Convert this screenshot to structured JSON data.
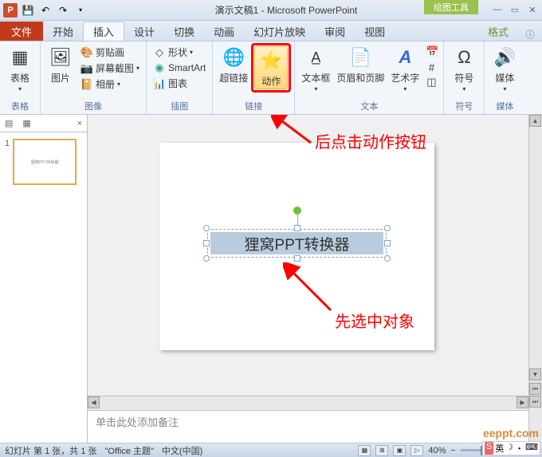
{
  "titlebar": {
    "app_label": "P",
    "doc_title": "演示文稿1 - Microsoft PowerPoint",
    "context_title": "绘图工具",
    "win_min": "—",
    "win_restore": "▭",
    "win_close": "✕"
  },
  "tabs": {
    "file": "文件",
    "home": "开始",
    "insert": "插入",
    "design": "设计",
    "transitions": "切换",
    "animations": "动画",
    "slideshow": "幻灯片放映",
    "review": "审阅",
    "view": "视图",
    "format": "格式"
  },
  "ribbon": {
    "tables": {
      "label": "表格",
      "btn": "表格"
    },
    "images": {
      "label": "图像",
      "picture": "图片",
      "clipart": "剪贴画",
      "screenshot": "屏幕截图",
      "album": "相册"
    },
    "illustrations": {
      "label": "插图",
      "shapes": "形状",
      "smartart": "SmartArt",
      "chart": "图表"
    },
    "links": {
      "label": "链接",
      "hyperlink": "超链接",
      "action": "动作"
    },
    "text": {
      "label": "文本",
      "textbox": "文本框",
      "headerfooter": "页眉和页脚",
      "wordart": "艺术字"
    },
    "symbols": {
      "label": "符号",
      "btn": "符号"
    },
    "media": {
      "label": "媒体",
      "btn": "媒体"
    }
  },
  "panel": {
    "tab_outline_icon": "▦",
    "tab_slides_icon": "▤",
    "close": "×",
    "slide_num": "1",
    "thumb_text": "狸窝PPT转换器"
  },
  "slide": {
    "textbox_text": "狸窝PPT转换器"
  },
  "annotations": {
    "anno1": "后点击动作按钮",
    "anno2": "先选中对象"
  },
  "notes": {
    "placeholder": "单击此处添加备注"
  },
  "status": {
    "slide_info": "幻灯片 第 1 张，共 1 张",
    "theme": "\"Office 主题\"",
    "lang": "中文(中国)",
    "zoom": "40%",
    "zoom_minus": "−",
    "zoom_plus": "+",
    "fit": "⛶"
  },
  "watermark": "eeppt.com",
  "ime": {
    "s": "S",
    "lang": "英",
    "moon": "☽",
    "dot": "・",
    "kb": "⌨"
  }
}
